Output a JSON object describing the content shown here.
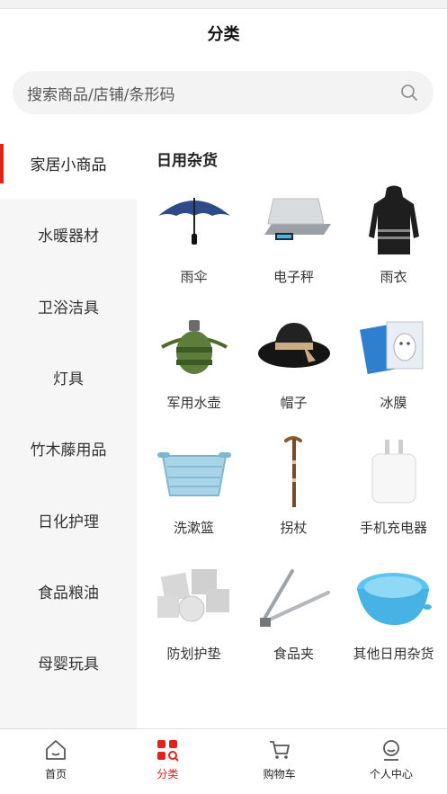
{
  "header": {
    "title": "分类"
  },
  "search": {
    "placeholder": "搜索商品/店铺/条形码"
  },
  "sidebar": {
    "items": [
      {
        "label": "家居小商品"
      },
      {
        "label": "水暖器材"
      },
      {
        "label": "卫浴洁具"
      },
      {
        "label": "灯具"
      },
      {
        "label": "竹木藤用品"
      },
      {
        "label": "日化护理"
      },
      {
        "label": "食品粮油"
      },
      {
        "label": "母婴玩具"
      }
    ],
    "active_index": 0
  },
  "section": {
    "title": "日用杂货"
  },
  "products": [
    {
      "name": "雨伞",
      "icon": "umbrella-icon"
    },
    {
      "name": "电子秤",
      "icon": "scale-icon"
    },
    {
      "name": "雨衣",
      "icon": "raincoat-icon"
    },
    {
      "name": "军用水壶",
      "icon": "canteen-icon"
    },
    {
      "name": "帽子",
      "icon": "hat-icon"
    },
    {
      "name": "冰膜",
      "icon": "face-mask-icon"
    },
    {
      "name": "洗漱篮",
      "icon": "basket-icon"
    },
    {
      "name": "拐杖",
      "icon": "cane-icon"
    },
    {
      "name": "手机充电器",
      "icon": "charger-icon"
    },
    {
      "name": "防划护垫",
      "icon": "felt-pads-icon"
    },
    {
      "name": "食品夹",
      "icon": "tongs-icon"
    },
    {
      "name": "其他日用杂货",
      "icon": "bowl-icon"
    }
  ],
  "tabbar": {
    "items": [
      {
        "label": "首页",
        "icon": "home-icon"
      },
      {
        "label": "分类",
        "icon": "category-icon"
      },
      {
        "label": "购物车",
        "icon": "cart-icon"
      },
      {
        "label": "个人中心",
        "icon": "profile-icon"
      }
    ],
    "active_index": 1
  },
  "colors": {
    "accent": "#e2231a",
    "sidebar_bg": "#f6f6f6",
    "search_bg": "#f3f3f3"
  }
}
